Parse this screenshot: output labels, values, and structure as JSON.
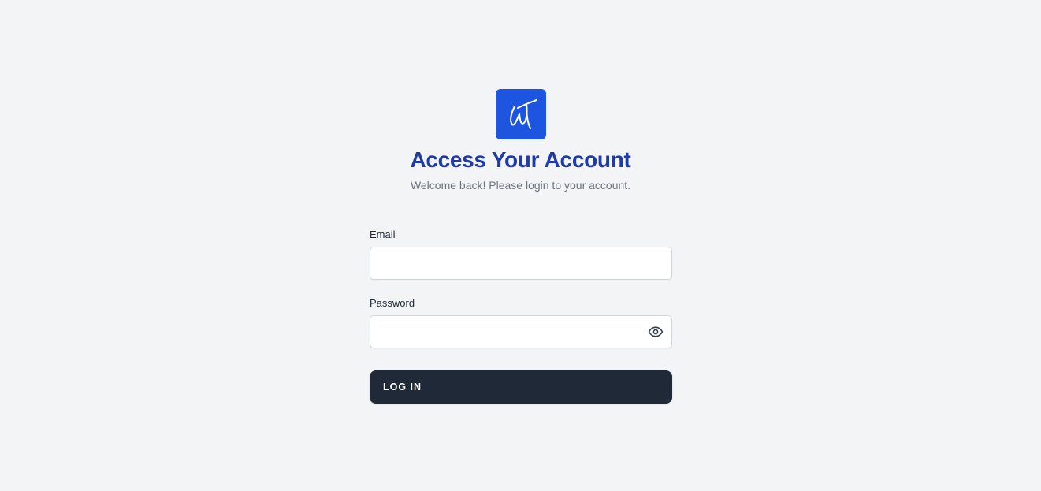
{
  "header": {
    "logo_icon": "signature-w-logo-icon",
    "title": "Access Your Account",
    "subtitle": "Welcome back! Please login to your account."
  },
  "form": {
    "email": {
      "label": "Email",
      "value": "",
      "placeholder": ""
    },
    "password": {
      "label": "Password",
      "value": "",
      "placeholder": "",
      "toggle_icon": "eye-icon"
    },
    "submit_label": "LOG IN"
  },
  "colors": {
    "background": "#f3f4f6",
    "logo_background": "#1e55e0",
    "title": "#1e3ba8",
    "subtitle": "#6b7280",
    "button_background": "#1f2937",
    "button_text": "#ffffff"
  }
}
